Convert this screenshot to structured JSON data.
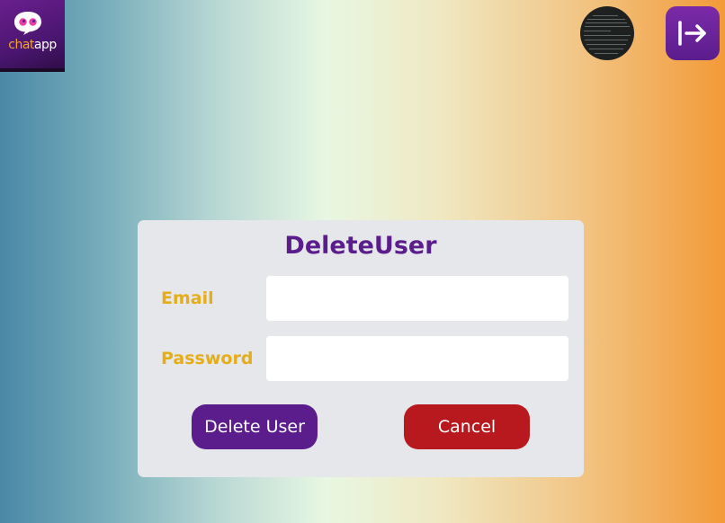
{
  "logo": {
    "brand_part1": "chat",
    "brand_part2": "app"
  },
  "header": {
    "avatar_icon": "profile-avatar",
    "logout_icon": "logout-arrow-icon"
  },
  "form": {
    "title": "DeleteUser",
    "email_label": "Email",
    "email_value": "",
    "password_label": "Password",
    "password_value": "",
    "delete_button": "Delete User",
    "cancel_button": "Cancel"
  },
  "colors": {
    "primary": "#5b1d8c",
    "danger": "#b8191e",
    "label": "#e4ad1a",
    "card_bg": "#e6e7eb"
  }
}
